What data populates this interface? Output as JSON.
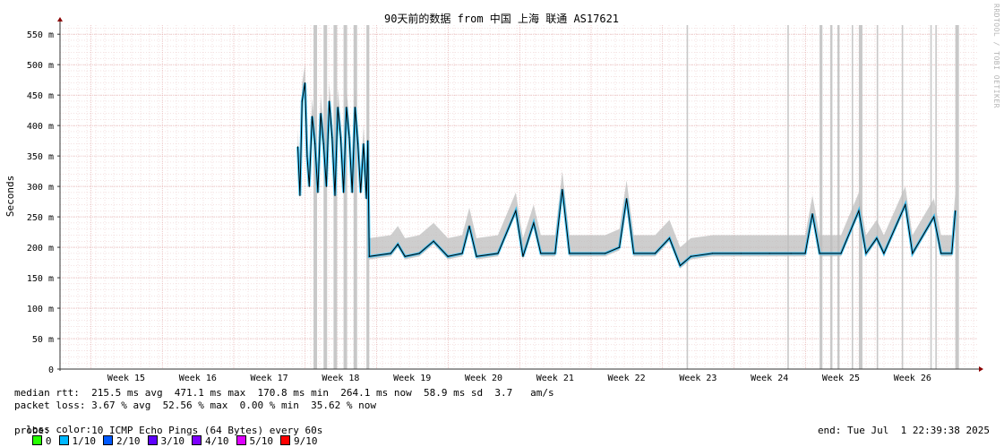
{
  "chart_data": {
    "type": "line",
    "title": "90天前的数据 from 中国 上海 联通 AS17621",
    "ylabel": "Seconds",
    "ylim": [
      0,
      0.565
    ],
    "yticks": [
      {
        "v": 0,
        "label": "0"
      },
      {
        "v": 0.05,
        "label": "50 m"
      },
      {
        "v": 0.1,
        "label": "100 m"
      },
      {
        "v": 0.15,
        "label": "150 m"
      },
      {
        "v": 0.2,
        "label": "200 m"
      },
      {
        "v": 0.25,
        "label": "250 m"
      },
      {
        "v": 0.3,
        "label": "300 m"
      },
      {
        "v": 0.35,
        "label": "350 m"
      },
      {
        "v": 0.4,
        "label": "400 m"
      },
      {
        "v": 0.45,
        "label": "450 m"
      },
      {
        "v": 0.5,
        "label": "500 m"
      },
      {
        "v": 0.55,
        "label": "550 m"
      }
    ],
    "xticks": [
      "Week 15",
      "Week 16",
      "Week 17",
      "Week 18",
      "Week 19",
      "Week 20",
      "Week 21",
      "Week 22",
      "Week 23",
      "Week 24",
      "Week 25",
      "Week 26"
    ],
    "grid": true,
    "series": [
      {
        "name": "median rtt",
        "color": "#000000",
        "points": [
          [
            2.4,
            0.365
          ],
          [
            2.43,
            0.285
          ],
          [
            2.46,
            0.44
          ],
          [
            2.5,
            0.47
          ],
          [
            2.53,
            0.35
          ],
          [
            2.56,
            0.3
          ],
          [
            2.6,
            0.415
          ],
          [
            2.64,
            0.37
          ],
          [
            2.68,
            0.29
          ],
          [
            2.72,
            0.42
          ],
          [
            2.76,
            0.37
          ],
          [
            2.8,
            0.3
          ],
          [
            2.84,
            0.44
          ],
          [
            2.88,
            0.38
          ],
          [
            2.92,
            0.285
          ],
          [
            2.96,
            0.43
          ],
          [
            3.0,
            0.38
          ],
          [
            3.04,
            0.29
          ],
          [
            3.08,
            0.43
          ],
          [
            3.12,
            0.38
          ],
          [
            3.16,
            0.29
          ],
          [
            3.2,
            0.43
          ],
          [
            3.24,
            0.37
          ],
          [
            3.28,
            0.29
          ],
          [
            3.32,
            0.37
          ],
          [
            3.36,
            0.28
          ],
          [
            3.38,
            0.375
          ],
          [
            3.4,
            0.185
          ],
          [
            3.7,
            0.19
          ],
          [
            3.8,
            0.205
          ],
          [
            3.9,
            0.185
          ],
          [
            4.1,
            0.19
          ],
          [
            4.3,
            0.21
          ],
          [
            4.5,
            0.185
          ],
          [
            4.7,
            0.19
          ],
          [
            4.8,
            0.235
          ],
          [
            4.9,
            0.185
          ],
          [
            5.2,
            0.19
          ],
          [
            5.45,
            0.26
          ],
          [
            5.55,
            0.185
          ],
          [
            5.7,
            0.24
          ],
          [
            5.8,
            0.19
          ],
          [
            6.0,
            0.19
          ],
          [
            6.1,
            0.295
          ],
          [
            6.2,
            0.19
          ],
          [
            6.5,
            0.19
          ],
          [
            6.7,
            0.19
          ],
          [
            6.9,
            0.2
          ],
          [
            7.0,
            0.28
          ],
          [
            7.1,
            0.19
          ],
          [
            7.4,
            0.19
          ],
          [
            7.6,
            0.215
          ],
          [
            7.75,
            0.17
          ],
          [
            7.9,
            0.185
          ],
          [
            8.2,
            0.19
          ],
          [
            8.6,
            0.19
          ],
          [
            9.0,
            0.19
          ],
          [
            9.3,
            0.19
          ],
          [
            9.5,
            0.19
          ],
          [
            9.6,
            0.255
          ],
          [
            9.7,
            0.19
          ],
          [
            10.0,
            0.19
          ],
          [
            10.25,
            0.26
          ],
          [
            10.35,
            0.19
          ],
          [
            10.5,
            0.215
          ],
          [
            10.6,
            0.19
          ],
          [
            10.9,
            0.27
          ],
          [
            11.0,
            0.19
          ],
          [
            11.3,
            0.25
          ],
          [
            11.4,
            0.19
          ],
          [
            11.55,
            0.19
          ],
          [
            11.6,
            0.26
          ]
        ]
      }
    ],
    "loss_spikes": [
      {
        "x": 2.62,
        "w": 0.05
      },
      {
        "x": 2.76,
        "w": 0.05
      },
      {
        "x": 2.9,
        "w": 0.05
      },
      {
        "x": 3.04,
        "w": 0.05
      },
      {
        "x": 3.18,
        "w": 0.05
      },
      {
        "x": 3.36,
        "w": 0.04
      },
      {
        "x": 7.84,
        "w": 0.02
      },
      {
        "x": 9.25,
        "w": 0.02
      },
      {
        "x": 9.7,
        "w": 0.04
      },
      {
        "x": 9.85,
        "w": 0.03
      },
      {
        "x": 9.95,
        "w": 0.03
      },
      {
        "x": 10.15,
        "w": 0.02
      },
      {
        "x": 10.25,
        "w": 0.05
      },
      {
        "x": 10.5,
        "w": 0.02
      },
      {
        "x": 10.85,
        "w": 0.02
      },
      {
        "x": 11.25,
        "w": 0.02
      },
      {
        "x": 11.32,
        "w": 0.02
      },
      {
        "x": 11.6,
        "w": 0.05
      }
    ]
  },
  "stats": {
    "median": "median rtt:  215.5 ms avg  471.1 ms max  170.8 ms min  264.1 ms now  58.9 ms sd  3.7   am/s",
    "loss": "packet loss: 3.67 % avg  52.56 % max  0.00 % min  35.62 % now",
    "legend_label": "loss color:",
    "legend": [
      {
        "label": "0",
        "color": "#26ff00"
      },
      {
        "label": "1/10",
        "color": "#00b8ff"
      },
      {
        "label": "2/10",
        "color": "#0059ff"
      },
      {
        "label": "3/10",
        "color": "#5e00ff"
      },
      {
        "label": "4/10",
        "color": "#7e00ff"
      },
      {
        "label": "5/10",
        "color": "#dd00ff"
      },
      {
        "label": "9/10",
        "color": "#ff0000"
      }
    ],
    "probe": "probe:       10 ICMP Echo Pings (64 Bytes) every 60s",
    "end": "end: Tue Jul  1 22:39:38 2025"
  },
  "watermark": "RRDTOOL / TOBI OETIKER"
}
